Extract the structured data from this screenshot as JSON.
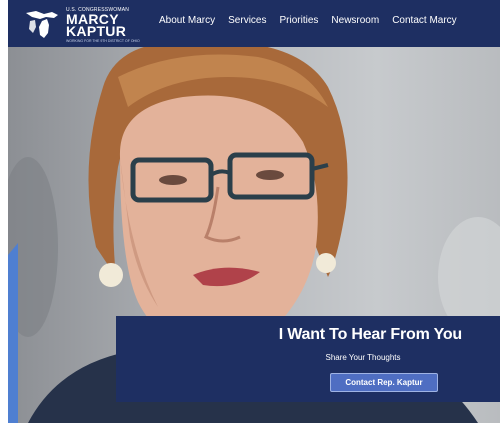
{
  "header": {
    "logo": {
      "small_line": "U.S. CONGRESSWOMAN",
      "first_name": "MARCY",
      "last_name": "KAPTUR",
      "tagline": "WORKING FOR THE 9TH DISTRICT OF OHIO"
    },
    "nav": [
      {
        "label": "About Marcy"
      },
      {
        "label": "Services"
      },
      {
        "label": "Priorities"
      },
      {
        "label": "Newsroom"
      },
      {
        "label": "Contact Marcy"
      }
    ]
  },
  "hero": {
    "image": "portrait-photo",
    "card": {
      "title": "I Want To Hear From You",
      "subtitle": "Share Your Thoughts",
      "button_label": "Contact Rep. Kaptur"
    }
  },
  "colors": {
    "header_bg": "#1e2f62",
    "card_bg": "#1e2f62",
    "button_bg": "#4f6ec2",
    "accent": "#4f7fd1"
  }
}
